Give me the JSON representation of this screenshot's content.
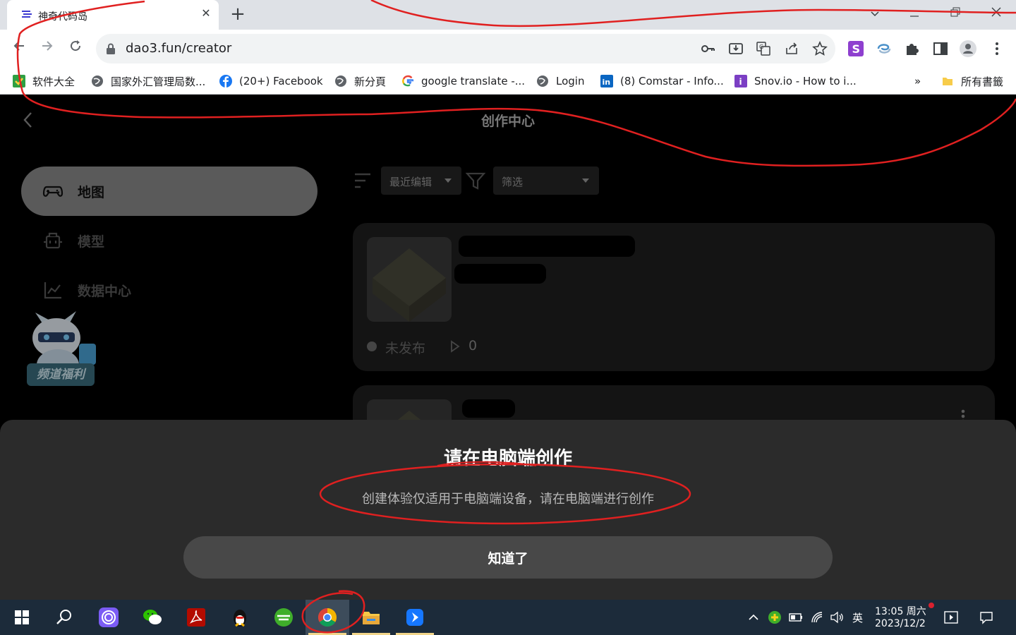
{
  "browser": {
    "tab_title": "神奇代码岛",
    "tab_close": "✕",
    "new_tab": "+",
    "url": "dao3.fun/creator",
    "bookmarks": [
      "软件大全",
      "国家外汇管理局数...",
      "(20+) Facebook",
      "新分頁",
      "google translate -...",
      "Login",
      "(8) Comstar - Info...",
      "Snov.io - How to i...",
      "所有書籤"
    ],
    "bookmarks_overflow": "»"
  },
  "page": {
    "title": "创作中心",
    "sidebar": {
      "items": [
        {
          "label": "地图",
          "icon": "gamepad-icon",
          "active": true
        },
        {
          "label": "模型",
          "icon": "model-icon",
          "active": false
        },
        {
          "label": "数据中心",
          "icon": "chart-line-icon",
          "active": false
        }
      ],
      "promo_label": "频道福利"
    },
    "toolbar": {
      "sort_value": "最近编辑",
      "filter_value": "筛选"
    },
    "cards": [
      {
        "status": "未发布",
        "plays": "0"
      }
    ]
  },
  "modal": {
    "title": "请在电脑端创作",
    "message": "创建体验仅适用于电脑端设备，请在电脑端进行创作",
    "confirm_label": "知道了"
  },
  "taskbar": {
    "ime": "英",
    "time": "13:05 周六",
    "date": "2023/12/2"
  },
  "colors": {
    "annotation": "#e02020",
    "page_bg": "#000000",
    "card_bg": "#1f1f1f",
    "sheet_bg": "#2b2b2b",
    "taskbar_bg": "#1c2b3a"
  }
}
